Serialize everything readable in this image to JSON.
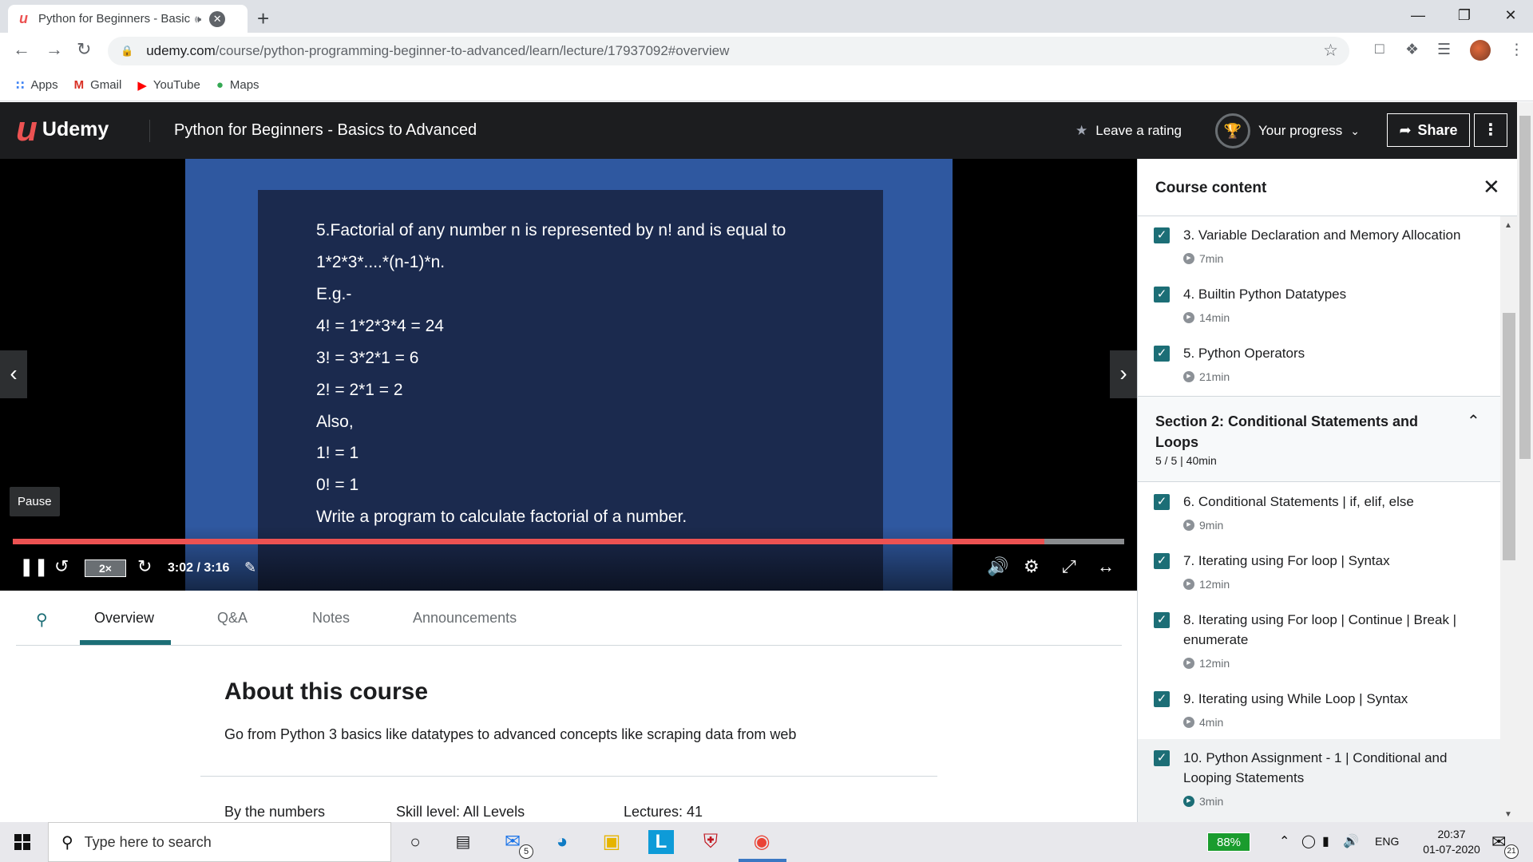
{
  "browser": {
    "tab_title": "Python for Beginners - Basics",
    "tab_favicon": "u",
    "url_host": "udemy.com",
    "url_path": "/course/python-programming-beginner-to-advanced/learn/lecture/17937092#overview",
    "bookmarks": [
      {
        "label": "Apps",
        "icon": "apps-grid-icon"
      },
      {
        "label": "Gmail",
        "icon": "gmail-icon"
      },
      {
        "label": "YouTube",
        "icon": "youtube-icon"
      },
      {
        "label": "Maps",
        "icon": "maps-pin-icon"
      }
    ]
  },
  "header": {
    "brand": "Udemy",
    "course_title": "Python for Beginners - Basics to Advanced",
    "rating_label": "Leave a rating",
    "progress_label": "Your progress",
    "share_label": "Share"
  },
  "player": {
    "slide_lines": [
      "5.Factorial of any number n is represented by n! and is equal to",
      " 1*2*3*....*(n-1)*n.",
      "E.g.-",
      "4! = 1*2*3*4 = 24",
      "3! = 3*2*1 = 6",
      "2! = 2*1 = 2",
      "Also,",
      "1! = 1",
      "0! = 1",
      "Write a program to calculate factorial of a number."
    ],
    "tooltip": "Pause",
    "speed": "2×",
    "timecode": "3:02 / 3:16",
    "progress_fraction": 0.928
  },
  "tabs": {
    "items": [
      "Overview",
      "Q&A",
      "Notes",
      "Announcements"
    ],
    "active": "Overview"
  },
  "about": {
    "title": "About this course",
    "description": "Go from Python 3 basics like datatypes to advanced concepts like scraping data from web",
    "stats": [
      "By the numbers",
      "Skill level: All Levels",
      "Lectures: 41"
    ]
  },
  "sidebar": {
    "title": "Course content",
    "lectures_top": [
      {
        "title": "3. Variable Declaration and Memory Allocation",
        "duration": "7min"
      },
      {
        "title": "4. Builtin Python Datatypes",
        "duration": "14min"
      },
      {
        "title": "5. Python Operators",
        "duration": "21min"
      }
    ],
    "section": {
      "title": "Section 2: Conditional Statements and Loops",
      "meta": "5 / 5 | 40min"
    },
    "lectures_section": [
      {
        "title": "6. Conditional Statements | if, elif, else",
        "duration": "9min"
      },
      {
        "title": "7. Iterating using For loop | Syntax",
        "duration": "12min"
      },
      {
        "title": "8. Iterating using For loop | Continue | Break | enumerate",
        "duration": "12min"
      },
      {
        "title": "9. Iterating using While Loop | Syntax",
        "duration": "4min"
      },
      {
        "title": "10. Python Assignment - 1 | Conditional and Looping Statements",
        "duration": "3min"
      }
    ]
  },
  "taskbar": {
    "search_placeholder": "Type here to search",
    "mail_badge": "5",
    "battery": "88%",
    "language": "ENG",
    "time": "20:37",
    "date": "01-07-2020",
    "notification_count": "21"
  },
  "colors": {
    "brand_red": "#ec5252",
    "teal": "#1c6e76",
    "dark": "#1c1d1f"
  }
}
